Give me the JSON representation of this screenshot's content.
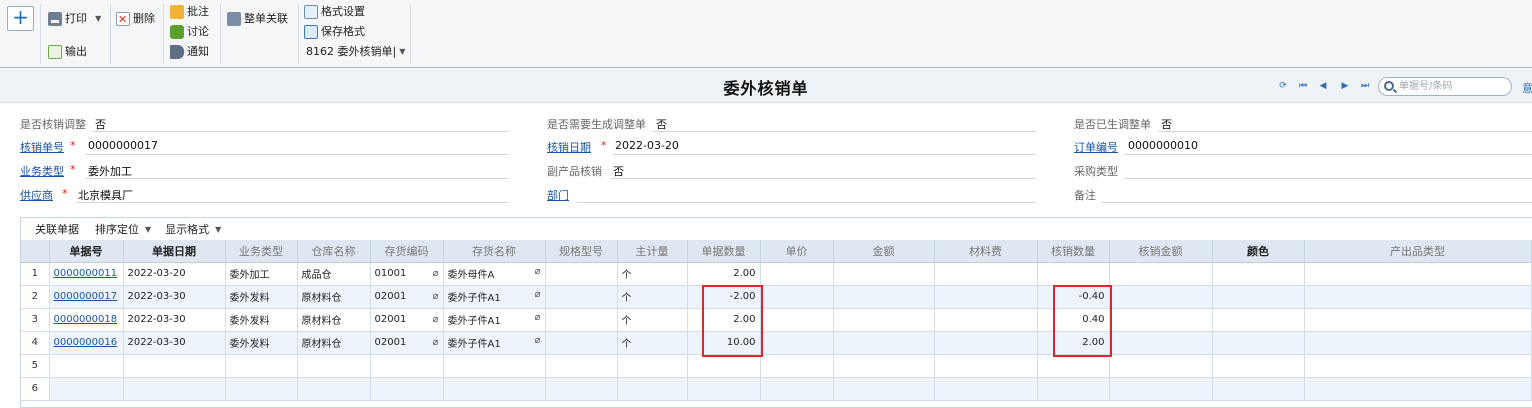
{
  "toolbar": {
    "add_label": "+",
    "print_label": "打印",
    "export_label": "输出",
    "delete_label": "删除",
    "annotate_label": "批注",
    "discuss_label": "讨论",
    "notify_label": "通知",
    "link_label": "整单关联",
    "format_label": "格式设置",
    "save_format_label": "保存格式",
    "template_label": "8162 委外核销单|"
  },
  "header": {
    "title": "委外核销单",
    "search_placeholder": "单据号/条码",
    "more": "意"
  },
  "form": {
    "is_adjust_label": "是否核销调整",
    "is_adjust_value": "否",
    "need_gen_label": "是否需要生成调整单",
    "need_gen_value": "否",
    "generated_label": "是否已生调整单",
    "generated_value": "否",
    "doc_no_label": "核销单号",
    "doc_no_value": "0000000017",
    "date_label": "核销日期",
    "date_value": "2022-03-20",
    "order_no_label": "订单编号",
    "order_no_value": "0000000010",
    "biz_type_label": "业务类型",
    "biz_type_value": "委外加工",
    "byproduct_label": "副产品核销",
    "byproduct_value": "否",
    "purchase_type_label": "采购类型",
    "purchase_type_value": "",
    "supplier_label": "供应商",
    "supplier_value": "北京模具厂",
    "dept_label": "部门",
    "dept_value": "",
    "remark_label": "备注",
    "remark_value": ""
  },
  "grid": {
    "tools": [
      "关联单据",
      "排序定位",
      "显示格式"
    ],
    "columns": [
      "单据号",
      "单据日期",
      "业务类型",
      "仓库名称",
      "存货编码",
      "存货名称",
      "规格型号",
      "主计量",
      "单据数量",
      "单价",
      "金额",
      "材料费",
      "核销数量",
      "核销金额",
      "颜色",
      "产出品类型"
    ],
    "rows": [
      {
        "rn": "1",
        "doc": "0000000011",
        "date": "2022-03-20",
        "biz": "委外加工",
        "wh": "成品仓",
        "code": "01001",
        "name": "委外母件A",
        "spec": "",
        "unit": "个",
        "qty": "2.00",
        "price": "",
        "amount": "",
        "material": "",
        "wo_qty": "",
        "wo_amount": "",
        "color": "",
        "output_type": ""
      },
      {
        "rn": "2",
        "doc": "0000000017",
        "date": "2022-03-30",
        "biz": "委外发料",
        "wh": "原材料仓",
        "code": "02001",
        "name": "委外子件A1",
        "spec": "",
        "unit": "个",
        "qty": "-2.00",
        "price": "",
        "amount": "",
        "material": "",
        "wo_qty": "-0.40",
        "wo_amount": "",
        "color": "",
        "output_type": ""
      },
      {
        "rn": "3",
        "doc": "0000000018",
        "date": "2022-03-30",
        "biz": "委外发料",
        "wh": "原材料仓",
        "code": "02001",
        "name": "委外子件A1",
        "spec": "",
        "unit": "个",
        "qty": "2.00",
        "price": "",
        "amount": "",
        "material": "",
        "wo_qty": "0.40",
        "wo_amount": "",
        "color": "",
        "output_type": ""
      },
      {
        "rn": "4",
        "doc": "0000000016",
        "date": "2022-03-30",
        "biz": "委外发料",
        "wh": "原材料仓",
        "code": "02001",
        "name": "委外子件A1",
        "spec": "",
        "unit": "个",
        "qty": "10.00",
        "price": "",
        "amount": "",
        "material": "",
        "wo_qty": "2.00",
        "wo_amount": "",
        "color": "",
        "output_type": ""
      },
      {
        "rn": "5",
        "doc": "",
        "date": "",
        "biz": "",
        "wh": "",
        "code": "",
        "name": "",
        "spec": "",
        "unit": "",
        "qty": "",
        "price": "",
        "amount": "",
        "material": "",
        "wo_qty": "",
        "wo_amount": "",
        "color": "",
        "output_type": ""
      },
      {
        "rn": "6",
        "doc": "",
        "date": "",
        "biz": "",
        "wh": "",
        "code": "",
        "name": "",
        "spec": "",
        "unit": "",
        "qty": "",
        "price": "",
        "amount": "",
        "material": "",
        "wo_qty": "",
        "wo_amount": "",
        "color": "",
        "output_type": ""
      }
    ]
  },
  "colors": {
    "accent": "#1a55a5",
    "highlight": "#e0262a",
    "row_alt": "#eef4fb"
  }
}
